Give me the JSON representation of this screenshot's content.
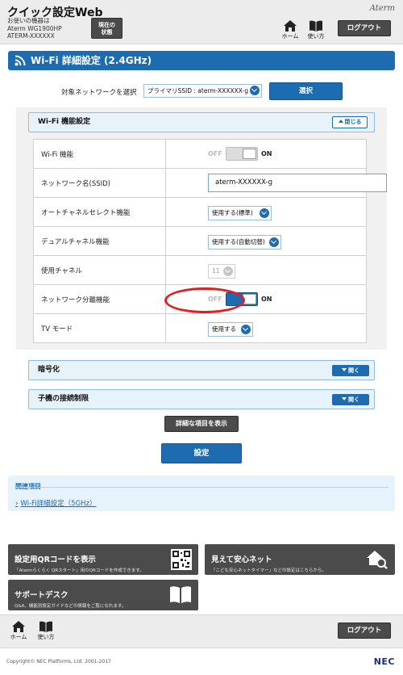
{
  "header": {
    "title": "クイック設定Web",
    "device_lines": [
      "お使いの機器は",
      "Aterm WG1900HP",
      "ATERM-XXXXXX"
    ],
    "status_button": [
      "現在の",
      "状態"
    ],
    "brand": "Aterm",
    "home_label": "ホーム",
    "manual_label": "使い方",
    "logout_label": "ログアウト"
  },
  "page": {
    "title": "Wi-Fi 詳細設定 (2.4GHz)"
  },
  "network_select": {
    "label": "対象ネットワークを選択",
    "value": "プライマリSSID : aterm-XXXXXX-g",
    "button": "選択"
  },
  "wifi_section": {
    "title": "Wi-Fi 機能設定",
    "close_label": "閉じる",
    "rows": [
      {
        "label": "Wi-Fi 機能",
        "state": "OFF",
        "on_label": "ON",
        "off_label": "OFF"
      },
      {
        "label": "ネットワーク名(SSID)",
        "value": "aterm-XXXXXX-g"
      },
      {
        "label": "オートチャネルセレクト機能",
        "value": "使用する(標準)"
      },
      {
        "label": "デュアルチャネル機能",
        "value": "使用する(自動切替)"
      },
      {
        "label": "使用チャネル",
        "value": "11"
      },
      {
        "label": "ネットワーク分離機能",
        "state": "ON",
        "on_label": "ON",
        "off_label": "OFF"
      },
      {
        "label": "TV モード",
        "value": "使用する"
      }
    ]
  },
  "sections": [
    {
      "title": "暗号化",
      "open_label": "開く"
    },
    {
      "title": "子機の接続制限",
      "open_label": "開く"
    }
  ],
  "actions": {
    "show_details": "詳細な項目を表示",
    "apply": "設定"
  },
  "related": {
    "title": "関連項目",
    "link": "Wi-Fi詳細設定（5GHz）"
  },
  "tiles": [
    {
      "title": "設定用QRコードを表示",
      "desc": "「Atermらくらく QRスタート」用のQRコードを作成できます。",
      "icon": "qr-code-icon"
    },
    {
      "title": "見えて安心ネット",
      "desc": "「こども安心ネットタイマー」などの設定はこちらから。",
      "icon": "home-search-icon"
    },
    {
      "title": "サポートデスク",
      "desc": "Q&A、機能別設定ガイドなどの情報をご覧になれます。",
      "icon": "book-icon"
    }
  ],
  "footer": {
    "home_label": "ホーム",
    "manual_label": "使い方",
    "logout_label": "ログアウト",
    "copyright": "Copyright© NEC Platforms, Ltd. 2001-2017",
    "logo": "NEC"
  },
  "colors": {
    "accent": "#1d6cb0",
    "highlight_ring": "#e02020",
    "tile_bg": "#4b4b4b"
  }
}
